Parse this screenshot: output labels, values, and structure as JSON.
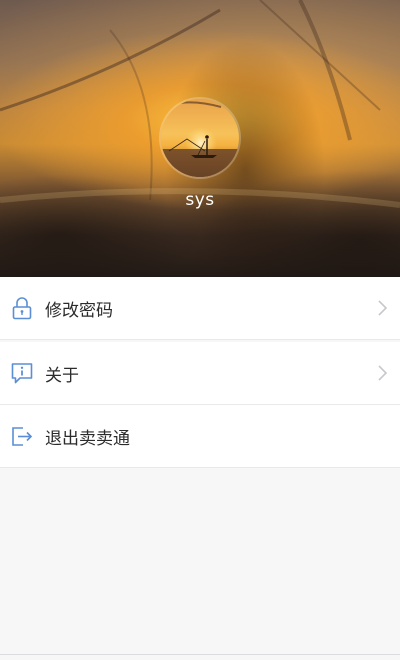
{
  "profile": {
    "username": "sys"
  },
  "menu": {
    "items": [
      {
        "label": "修改密码",
        "icon": "lock-icon",
        "has_chevron": true
      },
      {
        "label": "关于",
        "icon": "info-icon",
        "has_chevron": true
      },
      {
        "label": "退出卖卖通",
        "icon": "logout-icon",
        "has_chevron": false
      }
    ]
  },
  "colors": {
    "icon_blue": "#5b8ed6",
    "chevron": "#c7c7cc",
    "divider": "#e9e9ec",
    "background": "#f7f7f8"
  }
}
